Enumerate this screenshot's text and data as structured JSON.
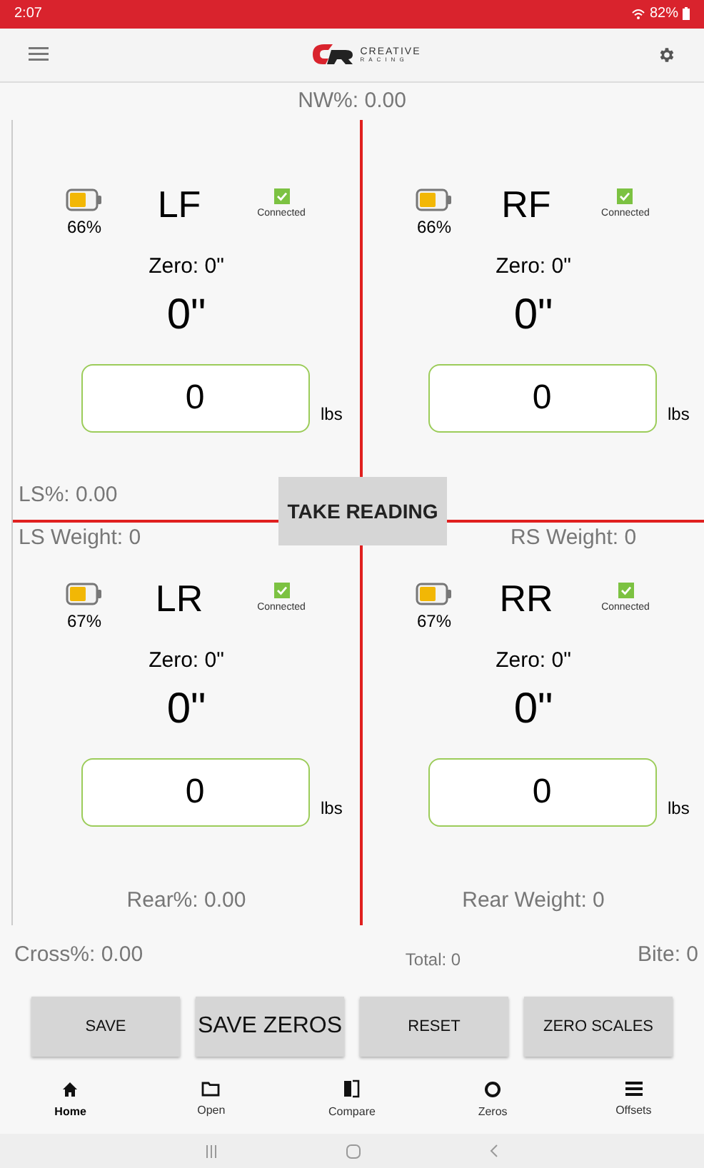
{
  "status_bar": {
    "time": "2:07",
    "battery": "82%"
  },
  "toolbar": {
    "logo_word": "CREATIVE",
    "logo_sub": "RACING"
  },
  "nw_percent": "NW%: 0.00",
  "wheels": [
    {
      "name": "LF",
      "battery": "66%",
      "connected": true,
      "connected_label": "Connected",
      "zero": "Zero: 0\"",
      "value": "0\"",
      "weight": "0",
      "unit": "lbs",
      "footer": "LS%: 0.00"
    },
    {
      "name": "RF",
      "battery": "66%",
      "connected": true,
      "connected_label": "Connected",
      "zero": "Zero: 0\"",
      "value": "0\"",
      "weight": "0",
      "unit": "lbs"
    },
    {
      "name": "LR",
      "battery": "67%",
      "connected": true,
      "connected_label": "Connected",
      "zero": "Zero: 0\"",
      "value": "0\"",
      "weight": "0",
      "unit": "lbs",
      "header": "LS Weight: 0",
      "footer": "Rear%: 0.00"
    },
    {
      "name": "RR",
      "battery": "67%",
      "connected": true,
      "connected_label": "Connected",
      "zero": "Zero: 0\"",
      "value": "0\"",
      "weight": "0",
      "unit": "lbs",
      "header": "RS Weight: 0",
      "footer": "Rear Weight: 0"
    }
  ],
  "take_reading": "TAKE READING",
  "totals": {
    "cross": "Cross%: 0.00",
    "total": "Total: 0",
    "bite": "Bite: 0"
  },
  "buttons": [
    {
      "label": "SAVE",
      "kind": "small"
    },
    {
      "label": "SAVE ZEROS",
      "kind": "large"
    },
    {
      "label": "RESET",
      "kind": "small"
    },
    {
      "label": "ZERO SCALES",
      "kind": "small"
    }
  ],
  "nav": [
    {
      "label": "Home",
      "kind": "home",
      "selected": true
    },
    {
      "label": "Open",
      "kind": "folder",
      "selected": false
    },
    {
      "label": "Compare",
      "kind": "compare",
      "selected": false
    },
    {
      "label": "Zeros",
      "kind": "ring",
      "selected": false
    },
    {
      "label": "Offsets",
      "kind": "list",
      "selected": false
    }
  ]
}
